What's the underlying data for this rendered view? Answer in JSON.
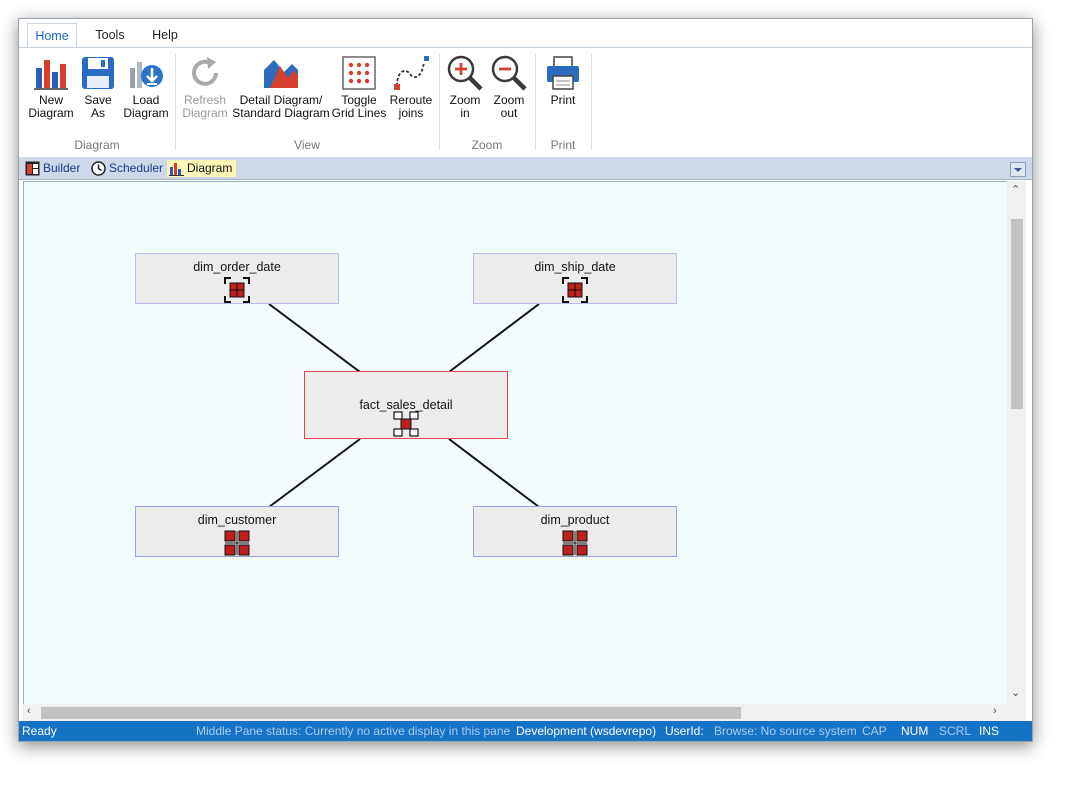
{
  "tabs": [
    "Home",
    "Tools",
    "Help"
  ],
  "ribbon": {
    "groups": {
      "diagram": {
        "label": "Diagram",
        "buttons": [
          {
            "l1": "New",
            "l2": "Diagram",
            "icon": "new-diagram-icon"
          },
          {
            "l1": "Save",
            "l2": "As",
            "icon": "save-icon"
          },
          {
            "l1": "Load",
            "l2": "Diagram",
            "icon": "load-diagram-icon"
          }
        ]
      },
      "view": {
        "label": "View",
        "buttons": [
          {
            "l1": "Refresh",
            "l2": "Diagram",
            "icon": "refresh-icon",
            "disabled": true
          },
          {
            "l1": "Detail Diagram/",
            "l2": "Standard Diagram",
            "icon": "detail-diagram-icon"
          },
          {
            "l1": "Toggle",
            "l2": "Grid Lines",
            "icon": "grid-icon"
          },
          {
            "l1": "Reroute",
            "l2": "joins",
            "icon": "reroute-icon"
          }
        ]
      },
      "zoom": {
        "label": "Zoom",
        "buttons": [
          {
            "l1": "Zoom",
            "l2": "in",
            "icon": "zoom-in-icon"
          },
          {
            "l1": "Zoom",
            "l2": "out",
            "icon": "zoom-out-icon"
          }
        ]
      },
      "print": {
        "label": "Print",
        "buttons": [
          {
            "l1": "Print",
            "l2": "",
            "icon": "printer-icon"
          }
        ]
      }
    }
  },
  "doc_tabs": [
    {
      "label": "Builder",
      "icon": "builder-icon"
    },
    {
      "label": "Scheduler",
      "icon": "clock-icon"
    },
    {
      "label": "Diagram",
      "icon": "diagram-chart-icon",
      "active": true
    }
  ],
  "diagram": {
    "nodes": {
      "order_date": "dim_order_date",
      "ship_date": "dim_ship_date",
      "fact": "fact_sales_detail",
      "customer": "dim_customer",
      "product": "dim_product"
    }
  },
  "status": {
    "ready": "Ready",
    "middle_pane": "Middle Pane status: Currently no active display in this pane",
    "environment": "Development (wsdevrepo)",
    "userid": "UserId:",
    "browse": "Browse: No source system",
    "cap": "CAP",
    "num": "NUM",
    "scrl": "SCRL",
    "ins": "INS"
  },
  "colors": {
    "accent": "#1e66c8",
    "status_bar": "#1672c4",
    "canvas_bg": "#f2fcfd",
    "fact_border": "#e04848",
    "dim_border": "#b9bde8"
  }
}
